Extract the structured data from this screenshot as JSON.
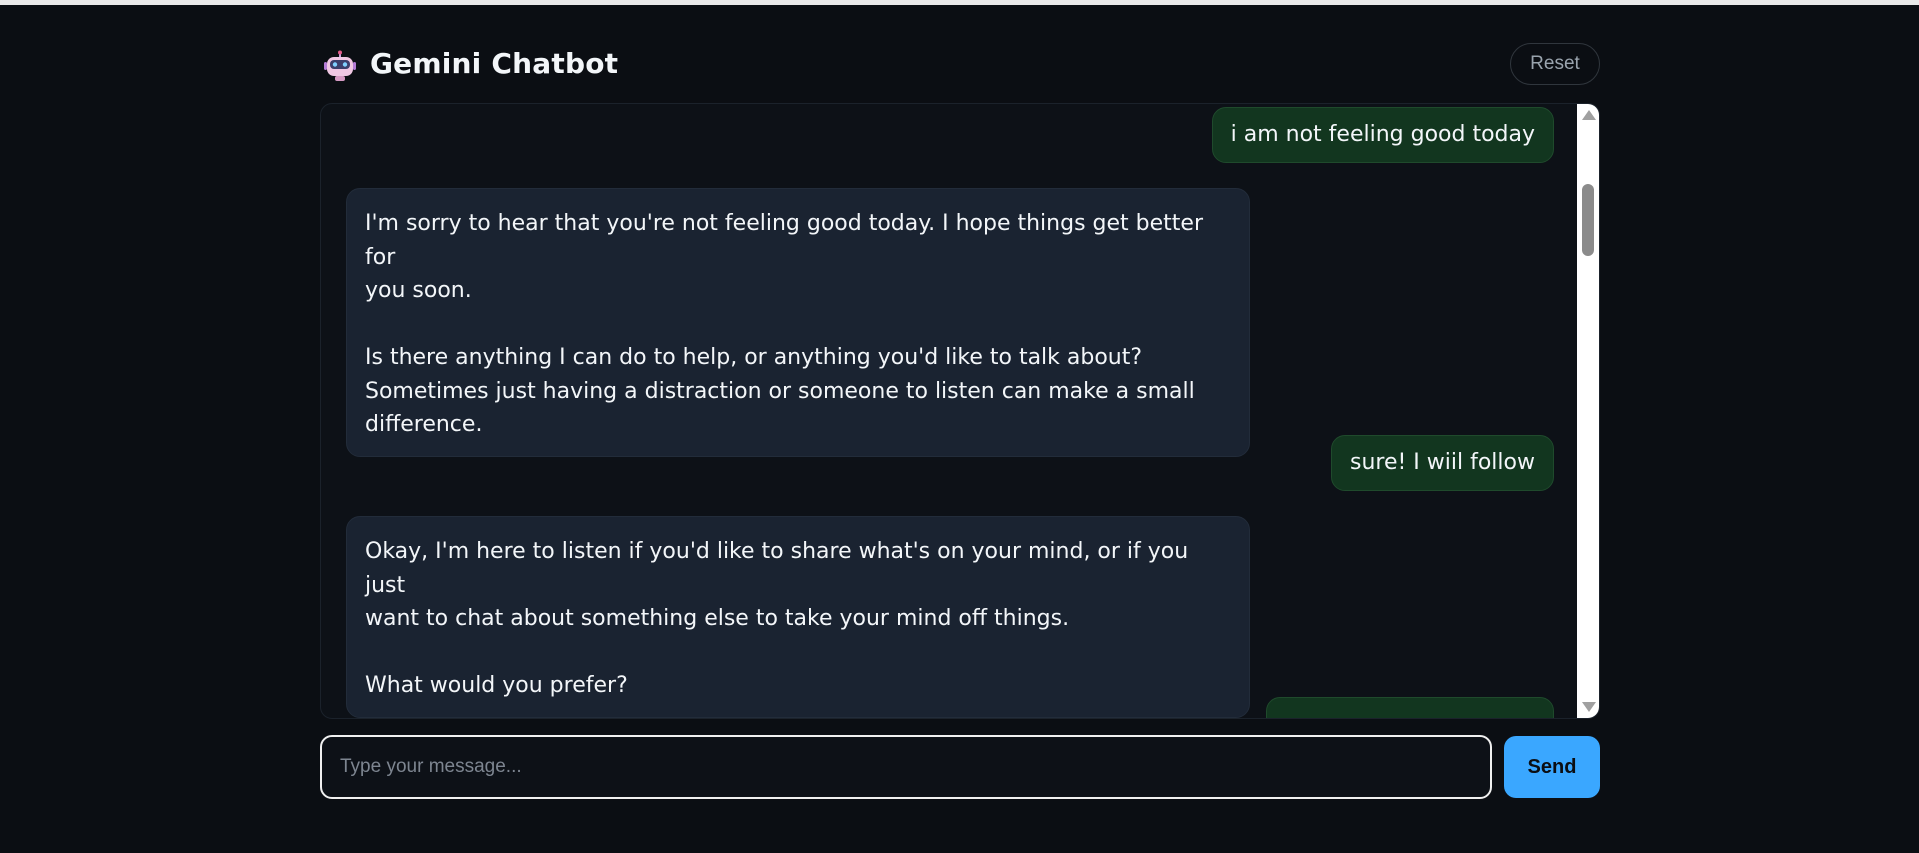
{
  "app": {
    "title": "Gemini Chatbot",
    "logo_icon": "robot-icon"
  },
  "header": {
    "reset_label": "Reset"
  },
  "messages": [
    {
      "role": "user",
      "text": "i am not feeling good today"
    },
    {
      "role": "bot",
      "text": "I'm sorry to hear that you're not feeling good today. I hope things get better for\nyou soon.\n\nIs there anything I can do to help, or anything you'd like to talk about?\nSometimes just having a distraction or someone to listen can make a small\ndifference."
    },
    {
      "role": "user",
      "text": "sure! I wiil follow"
    },
    {
      "role": "bot",
      "text": "Okay, I'm here to listen if you'd like to share what's on your mind, or if you just\nwant to chat about something else to take your mind off things.\n\nWhat would you prefer?"
    },
    {
      "role": "user",
      "text": ""
    }
  ],
  "composer": {
    "placeholder": "Type your message...",
    "value": "",
    "send_label": "Send"
  },
  "colors": {
    "background": "#0b0e13",
    "user_bubble": "#12361f",
    "bot_bubble": "#1a2331",
    "send_button": "#3aa7ff"
  }
}
